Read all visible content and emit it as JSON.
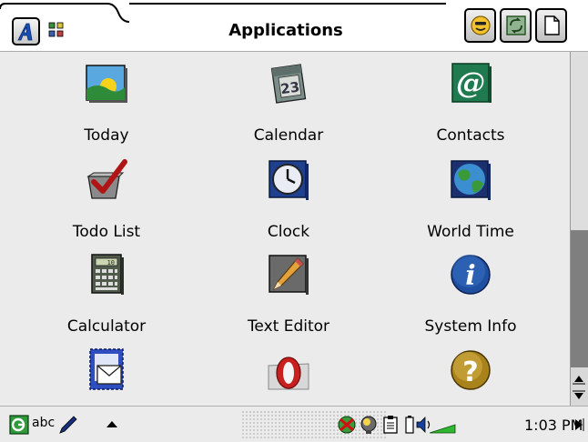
{
  "window": {
    "title": "Applications"
  },
  "titlebar": {
    "launcher_icon": "app-launcher-a-icon",
    "view_icon": "grid-view-icon",
    "right_buttons": [
      "smiley-icon",
      "sync-icon",
      "document-icon"
    ]
  },
  "apps": [
    {
      "label": "Today",
      "icon": "today-landscape-icon"
    },
    {
      "label": "Calendar",
      "icon": "calendar-icon"
    },
    {
      "label": "Contacts",
      "icon": "contacts-at-icon"
    },
    {
      "label": "Todo List",
      "icon": "todo-checkmark-icon"
    },
    {
      "label": "Clock",
      "icon": "clock-icon"
    },
    {
      "label": "World Time",
      "icon": "globe-icon"
    },
    {
      "label": "Calculator",
      "icon": "calculator-icon"
    },
    {
      "label": "Text Editor",
      "icon": "text-editor-pencil-icon"
    },
    {
      "label": "System Info",
      "icon": "info-icon"
    },
    {
      "label": "",
      "icon": "mail-stamp-icon"
    },
    {
      "label": "",
      "icon": "opera-browser-icon"
    },
    {
      "label": "",
      "icon": "help-question-icon"
    }
  ],
  "statusbar": {
    "input_mode": "abc",
    "time": "1:03 PM",
    "tray_icons": [
      "network-icon",
      "lightbulb-icon",
      "clipboard-icon",
      "battery-icon",
      "volume-icon"
    ]
  },
  "colors": {
    "accent": "#1a4fb5",
    "main_background": "#ebebeb",
    "scroll_track": "#7f7f7f"
  }
}
